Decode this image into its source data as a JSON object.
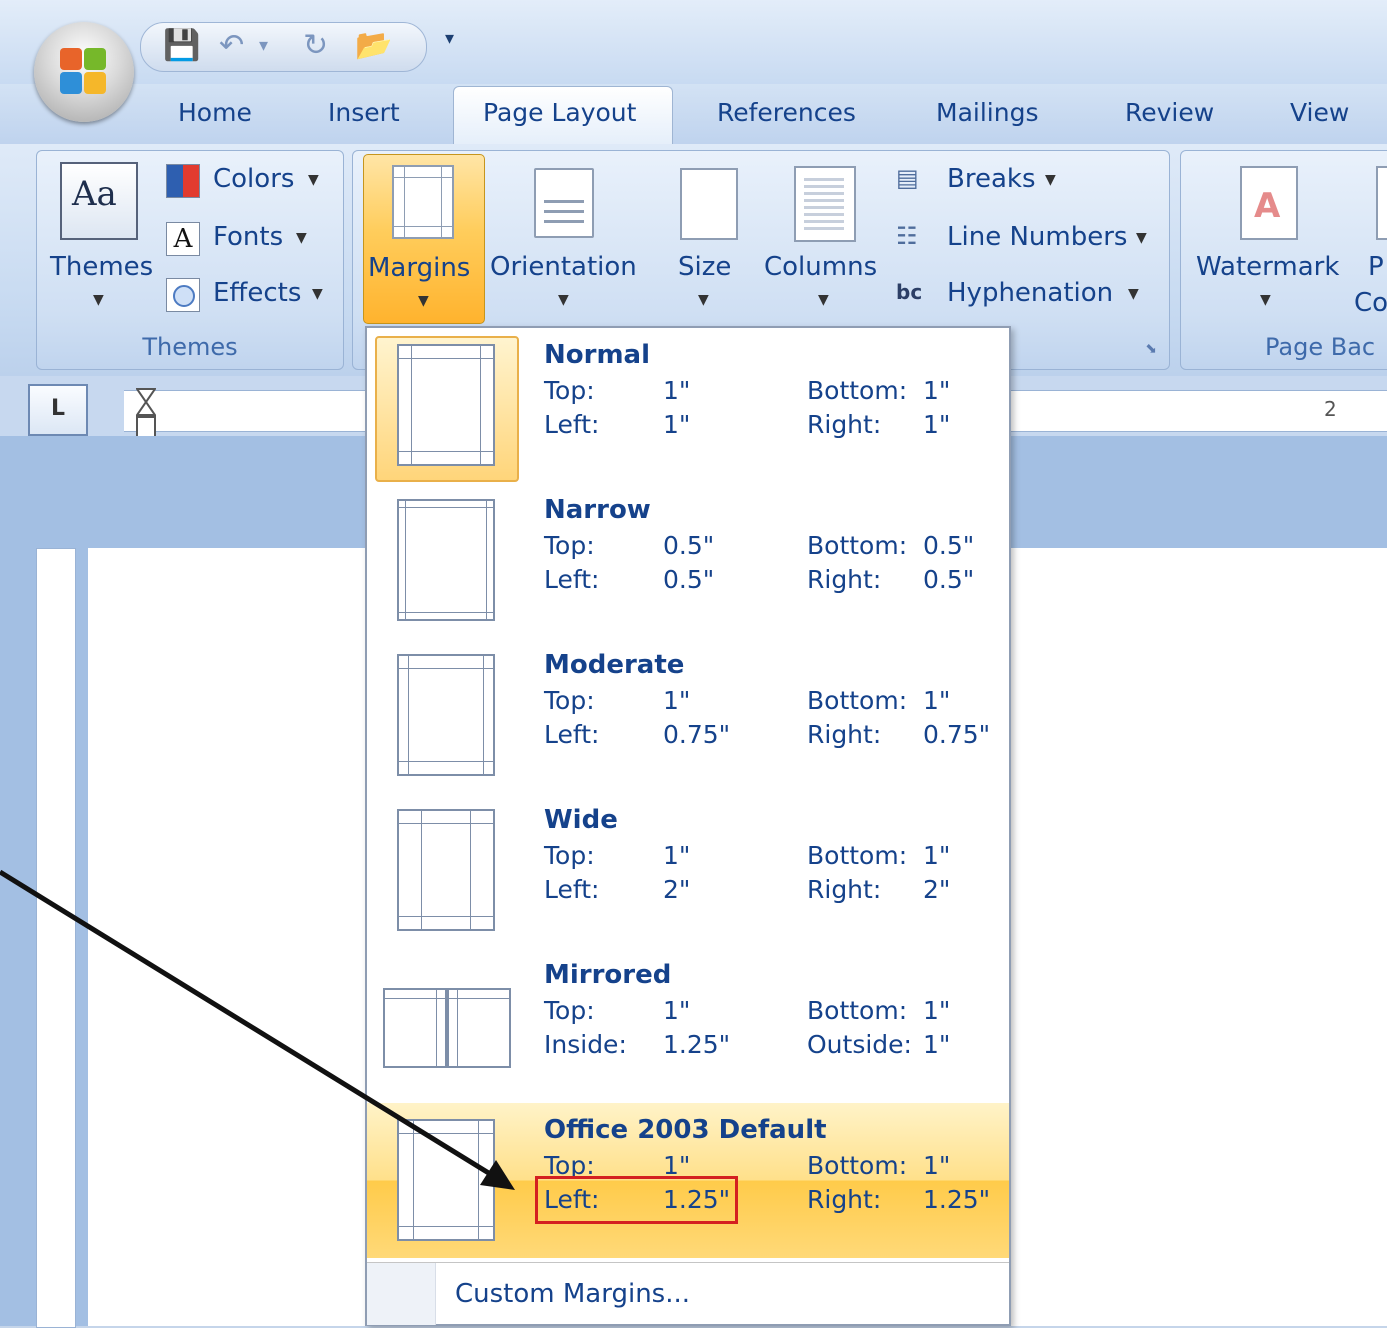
{
  "quick_access": {
    "more": "▾"
  },
  "tabs": [
    {
      "label": "Home"
    },
    {
      "label": "Insert"
    },
    {
      "label": "Page Layout",
      "active": true
    },
    {
      "label": "References"
    },
    {
      "label": "Mailings"
    },
    {
      "label": "Review"
    },
    {
      "label": "View"
    }
  ],
  "ribbon": {
    "themes_group": {
      "label": "Themes",
      "themes_button": "Themes",
      "colors": "Colors",
      "fonts": "Fonts",
      "effects": "Effects"
    },
    "page_setup_group": {
      "margins": "Margins",
      "orientation": "Orientation",
      "size": "Size",
      "columns": "Columns",
      "breaks": "Breaks",
      "line_numbers": "Line Numbers",
      "hyphenation": "Hyphenation"
    },
    "page_background_group": {
      "label": "Page Bac",
      "watermark": "Watermark",
      "page_color_partial_1": "P",
      "page_color_partial_2": "Co"
    }
  },
  "ruler": {
    "corner": "L",
    "tick_label": "2"
  },
  "margins_menu": {
    "items": [
      {
        "name": "Normal",
        "k1": "Top:",
        "v1": "1\"",
        "k2": "Bottom:",
        "v2": "1\"",
        "k3": "Left:",
        "v3": "1\"",
        "k4": "Right:",
        "v4": "1\"",
        "selected": true
      },
      {
        "name": "Narrow",
        "k1": "Top:",
        "v1": "0.5\"",
        "k2": "Bottom:",
        "v2": "0.5\"",
        "k3": "Left:",
        "v3": "0.5\"",
        "k4": "Right:",
        "v4": "0.5\""
      },
      {
        "name": "Moderate",
        "k1": "Top:",
        "v1": "1\"",
        "k2": "Bottom:",
        "v2": "1\"",
        "k3": "Left:",
        "v3": "0.75\"",
        "k4": "Right:",
        "v4": "0.75\""
      },
      {
        "name": "Wide",
        "k1": "Top:",
        "v1": "1\"",
        "k2": "Bottom:",
        "v2": "1\"",
        "k3": "Left:",
        "v3": "2\"",
        "k4": "Right:",
        "v4": "2\""
      },
      {
        "name": "Mirrored",
        "k1": "Top:",
        "v1": "1\"",
        "k2": "Bottom:",
        "v2": "1\"",
        "k3": "Inside:",
        "v3": "1.25\"",
        "k4": "Outside:",
        "v4": "1\""
      },
      {
        "name": "Office 2003 Default",
        "k1": "Top:",
        "v1": "1\"",
        "k2": "Bottom:",
        "v2": "1\"",
        "k3": "Left:",
        "v3": "1.25\"",
        "k4": "Right:",
        "v4": "1.25\"",
        "hovered": true
      }
    ],
    "custom": "Custom Margins..."
  },
  "colors": {
    "accent_hover": "#ffc44a",
    "highlight_box": "#d42020",
    "text": "#15428b"
  }
}
